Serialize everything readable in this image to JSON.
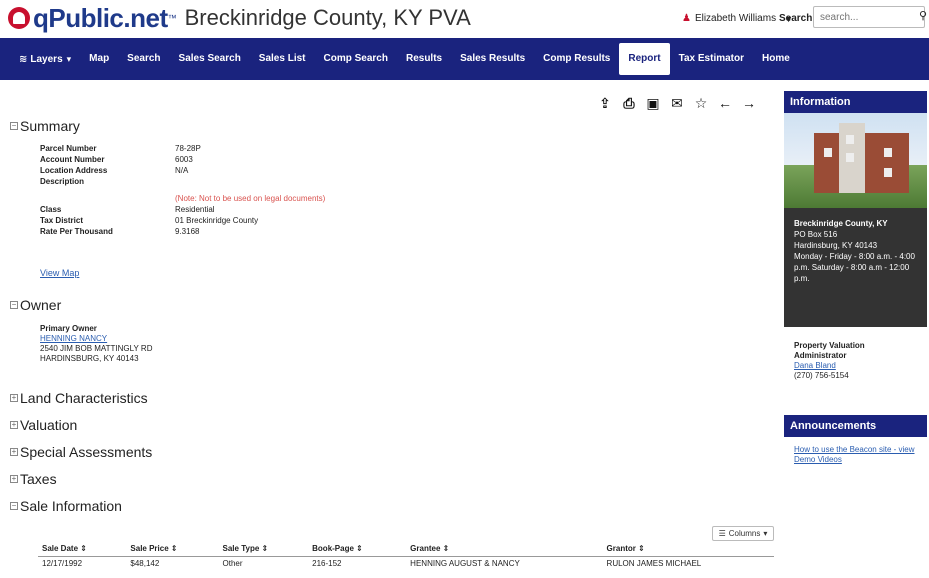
{
  "header": {
    "logo_text": "qPublic.net",
    "logo_tm": "™",
    "county_title": "Breckinridge County, KY PVA",
    "user_name": "Elizabeth Williams",
    "search_label": "Search",
    "search_placeholder": "search..."
  },
  "nav": {
    "items": [
      {
        "label": "Layers",
        "active": false
      },
      {
        "label": "Map",
        "active": false
      },
      {
        "label": "Search",
        "active": false
      },
      {
        "label": "Sales Search",
        "active": false
      },
      {
        "label": "Sales List",
        "active": false
      },
      {
        "label": "Comp Search",
        "active": false
      },
      {
        "label": "Results",
        "active": false
      },
      {
        "label": "Sales Results",
        "active": false
      },
      {
        "label": "Comp Results",
        "active": false
      },
      {
        "label": "Report",
        "active": true
      },
      {
        "label": "Tax Estimator",
        "active": false
      },
      {
        "label": "Home",
        "active": false
      }
    ]
  },
  "toolbar": {
    "icons": [
      "share-icon",
      "print-icon",
      "image-icon",
      "email-icon",
      "star-icon",
      "back-arrow-icon",
      "forward-arrow-icon"
    ]
  },
  "summary": {
    "title": "Summary",
    "rows": [
      {
        "key": "Parcel Number",
        "value": "78-28P"
      },
      {
        "key": "Account Number",
        "value": "6003"
      },
      {
        "key": "Location Address",
        "value": "N/A"
      },
      {
        "key": "Description",
        "value": ""
      },
      {
        "key": "",
        "value": "(Note: Not to be used on legal documents)"
      },
      {
        "key": "Class",
        "value": "Residential"
      },
      {
        "key": "Tax District",
        "value": "01 Breckinridge County"
      },
      {
        "key": "Rate Per Thousand",
        "value": "9.3168"
      }
    ],
    "view_map": "View Map"
  },
  "owner": {
    "title": "Owner",
    "label": "Primary Owner",
    "name": "HENNING NANCY",
    "address1": "2540 JIM BOB MATTINGLY RD",
    "address2": "HARDINSBURG, KY 40143"
  },
  "sections": {
    "land": "Land Characteristics",
    "valuation": "Valuation",
    "special": "Special Assessments",
    "taxes": "Taxes",
    "sale": "Sale Information"
  },
  "sale": {
    "columns_label": "Columns",
    "headers": [
      "Sale Date",
      "Sale Price",
      "Sale Type",
      "Book-Page",
      "Grantee",
      "Grantor"
    ],
    "rows": [
      [
        "12/17/1992",
        "$48,142",
        "Other",
        "216-152",
        "HENNING AUGUST & NANCY",
        "RULON JAMES MICHAEL"
      ]
    ]
  },
  "sidebar": {
    "info_title": "Information",
    "office_name": "Breckinridge County, KY",
    "office_line1": "PO Box 516",
    "office_line2": "Hardinsburg, KY 40143",
    "office_hours": "Monday - Friday - 8:00 a.m. - 4:00 p.m. Saturday - 8:00 a.m - 12:00 p.m.",
    "pva_label_1": "Property Valuation",
    "pva_label_2": "Administrator",
    "pva_name": "Dana Bland",
    "pva_phone": "(270) 756-5154",
    "announcements_title": "Announcements",
    "announcement_link": "How to use the Beacon site - view Demo Videos"
  }
}
